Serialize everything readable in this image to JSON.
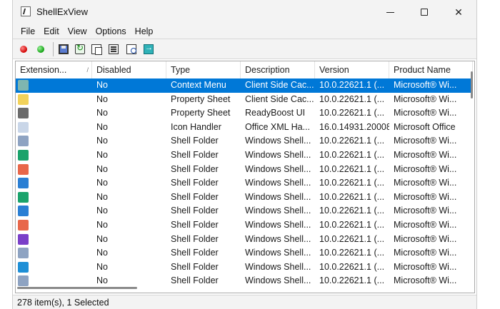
{
  "window": {
    "title": "ShellExView"
  },
  "menu": [
    "File",
    "Edit",
    "View",
    "Options",
    "Help"
  ],
  "toolbar": {
    "buttons": [
      {
        "name": "disable-items-button",
        "icon": "red-dot-icon"
      },
      {
        "name": "enable-items-button",
        "icon": "green-dot-icon"
      },
      {
        "name": "save-button",
        "icon": "floppy-disk-icon"
      },
      {
        "name": "refresh-button",
        "icon": "refresh-icon"
      },
      {
        "name": "copy-button",
        "icon": "copy-icon"
      },
      {
        "name": "properties-button",
        "icon": "properties-icon"
      },
      {
        "name": "find-button",
        "icon": "find-icon"
      },
      {
        "name": "exit-button",
        "icon": "exit-icon"
      }
    ]
  },
  "columns": [
    "Extension...",
    "Disabled",
    "Type",
    "Description",
    "Version",
    "Product Name"
  ],
  "sort_glyph": "/",
  "rows": [
    {
      "icon": "context-menu-icon",
      "icon_color": "#7fb6b0",
      "disabled": "No",
      "type": "Context Menu",
      "description": "Client Side Cac...",
      "version": "10.0.22621.1 (...",
      "product": "Microsoft® Wi...",
      "selected": true
    },
    {
      "icon": "property-sheet-icon",
      "icon_color": "#f2d25a",
      "disabled": "No",
      "type": "Property Sheet",
      "description": "Client Side Cac...",
      "version": "10.0.22621.1 (...",
      "product": "Microsoft® Wi..."
    },
    {
      "icon": "drive-icon",
      "icon_color": "#6b6b6b",
      "disabled": "No",
      "type": "Property Sheet",
      "description": "ReadyBoost UI",
      "version": "10.0.22621.1 (...",
      "product": "Microsoft® Wi..."
    },
    {
      "icon": "xml-file-icon",
      "icon_color": "#c9d6e8",
      "disabled": "No",
      "type": "Icon Handler",
      "description": "Office XML Ha...",
      "version": "16.0.14931.20008",
      "product": "Microsoft Office"
    },
    {
      "icon": "documents-folder-icon",
      "icon_color": "#8ea3c2",
      "disabled": "No",
      "type": "Shell Folder",
      "description": "Windows Shell...",
      "version": "10.0.22621.1 (...",
      "product": "Microsoft® Wi..."
    },
    {
      "icon": "downloads-folder-icon",
      "icon_color": "#1aa36b",
      "disabled": "No",
      "type": "Shell Folder",
      "description": "Windows Shell...",
      "version": "10.0.22621.1 (...",
      "product": "Microsoft® Wi..."
    },
    {
      "icon": "music-folder-icon",
      "icon_color": "#e8674a",
      "disabled": "No",
      "type": "Shell Folder",
      "description": "Windows Shell...",
      "version": "10.0.22621.1 (...",
      "product": "Microsoft® Wi..."
    },
    {
      "icon": "pictures-folder-icon",
      "icon_color": "#2a7fd4",
      "disabled": "No",
      "type": "Shell Folder",
      "description": "Windows Shell...",
      "version": "10.0.22621.1 (...",
      "product": "Microsoft® Wi..."
    },
    {
      "icon": "downloads-folder-icon",
      "icon_color": "#1aa36b",
      "disabled": "No",
      "type": "Shell Folder",
      "description": "Windows Shell...",
      "version": "10.0.22621.1 (...",
      "product": "Microsoft® Wi..."
    },
    {
      "icon": "pictures-folder-icon",
      "icon_color": "#2a7fd4",
      "disabled": "No",
      "type": "Shell Folder",
      "description": "Windows Shell...",
      "version": "10.0.22621.1 (...",
      "product": "Microsoft® Wi..."
    },
    {
      "icon": "music-folder-icon",
      "icon_color": "#e8674a",
      "disabled": "No",
      "type": "Shell Folder",
      "description": "Windows Shell...",
      "version": "10.0.22621.1 (...",
      "product": "Microsoft® Wi..."
    },
    {
      "icon": "videos-folder-icon",
      "icon_color": "#7a3fc8",
      "disabled": "No",
      "type": "Shell Folder",
      "description": "Windows Shell...",
      "version": "10.0.22621.1 (...",
      "product": "Microsoft® Wi..."
    },
    {
      "icon": "documents-folder-icon",
      "icon_color": "#8ea3c2",
      "disabled": "No",
      "type": "Shell Folder",
      "description": "Windows Shell...",
      "version": "10.0.22621.1 (...",
      "product": "Microsoft® Wi..."
    },
    {
      "icon": "desktop-folder-icon",
      "icon_color": "#1e8fd6",
      "disabled": "No",
      "type": "Shell Folder",
      "description": "Windows Shell...",
      "version": "10.0.22621.1 (...",
      "product": "Microsoft® Wi..."
    },
    {
      "icon": "folder-icon",
      "icon_color": "#8ea3c2",
      "disabled": "No",
      "type": "Shell Folder",
      "description": "Windows Shell...",
      "version": "10.0.22621.1 (...",
      "product": "Microsoft® Wi..."
    }
  ],
  "status": {
    "text": "278 item(s), 1 Selected"
  },
  "colors": {
    "selection": "#0078d7",
    "chrome": "#f3f3f3"
  }
}
